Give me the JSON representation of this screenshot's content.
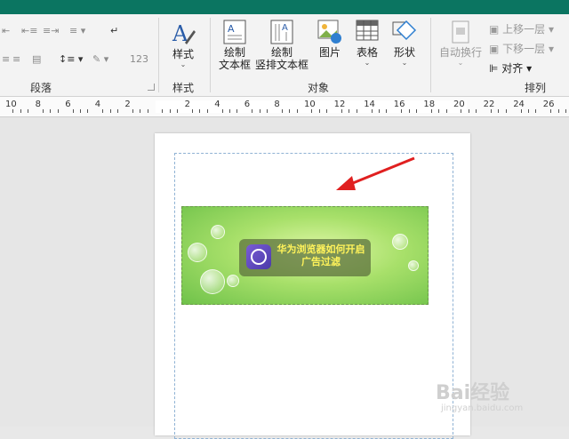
{
  "ribbon": {
    "groups": {
      "paragraph": "段落",
      "style": "样式",
      "objects": "对象",
      "arrange": "排列"
    },
    "buttons": {
      "style": "样式",
      "draw_textbox_l1": "绘制",
      "draw_textbox_l2": "文本框",
      "draw_vertical_l1": "绘制",
      "draw_vertical_l2": "竖排文本框",
      "picture": "图片",
      "table": "表格",
      "shape": "形状",
      "auto_wrap": "自动换行",
      "bring_forward": "上移一层",
      "send_backward": "下移一层",
      "align": "对齐"
    },
    "small": {
      "numbering": "123"
    }
  },
  "ruler": {
    "labels": [
      "10",
      "8",
      "6",
      "4",
      "2",
      "",
      "2",
      "4",
      "6",
      "8",
      "10",
      "12",
      "14",
      "16",
      "18",
      "20",
      "22",
      "24",
      "26"
    ]
  },
  "document": {
    "banner_title_l1": "华为浏览器如何开启",
    "banner_title_l2": "广告过滤"
  },
  "watermark": {
    "brand": "Bai经验",
    "url": "jingyan.baidu.com"
  },
  "colors": {
    "titlebar": "#0b7561",
    "arrow": "#e02020",
    "banner_text": "#fff35a"
  }
}
